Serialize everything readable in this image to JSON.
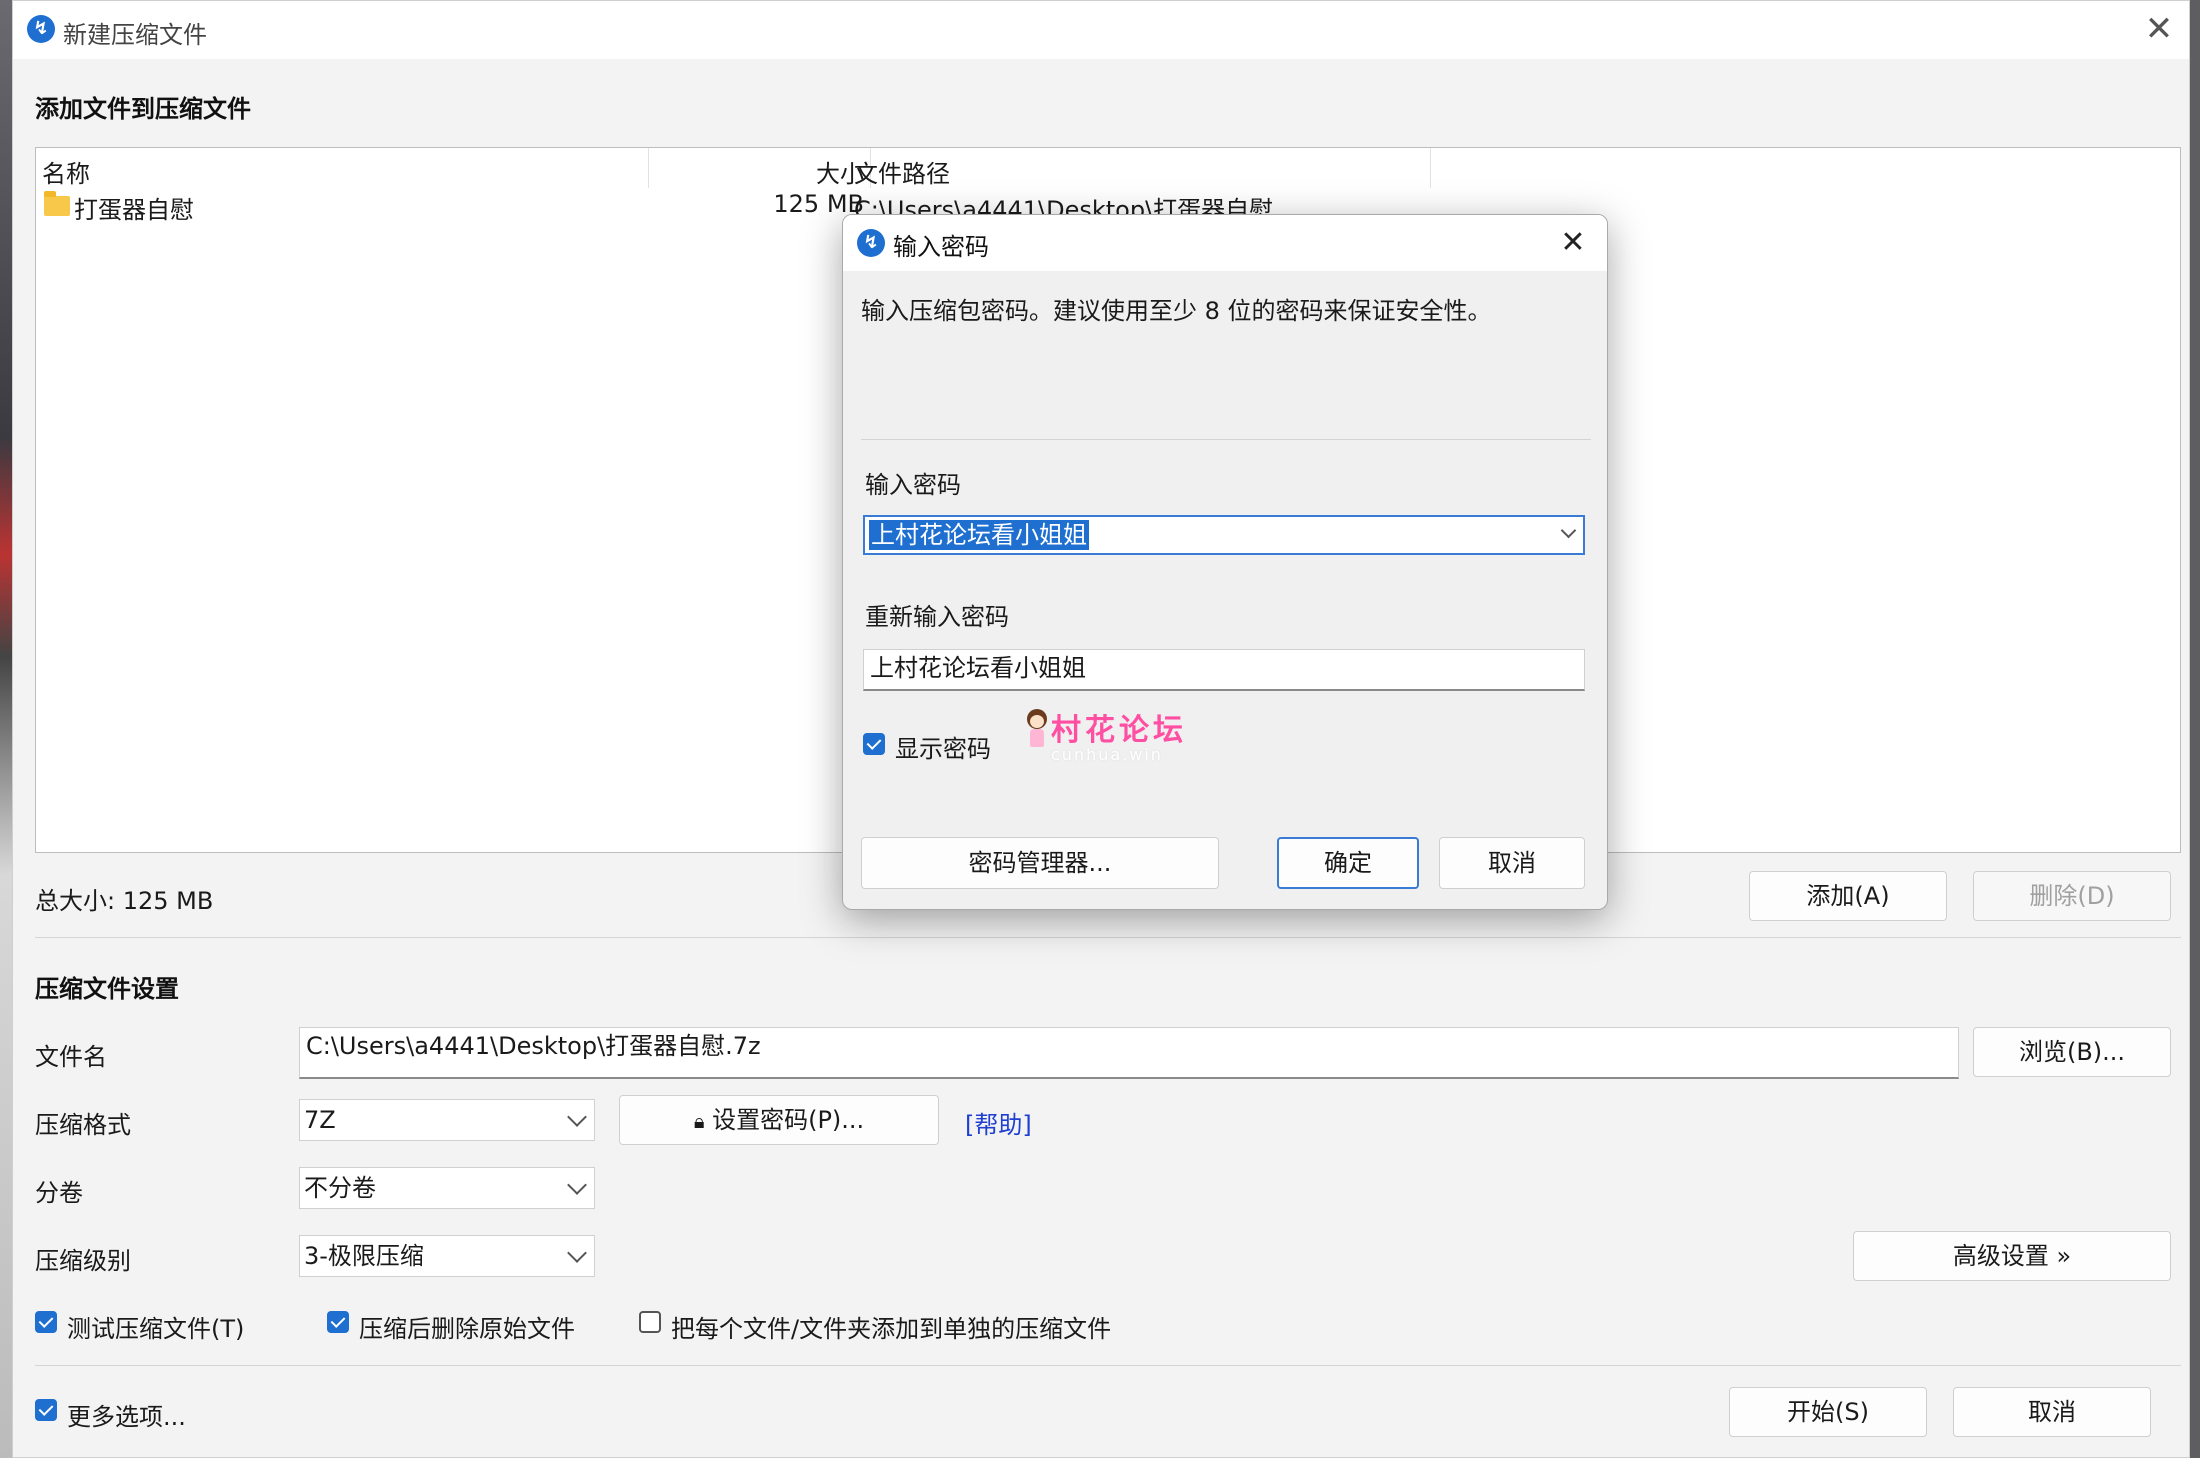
{
  "window": {
    "title": "新建压缩文件",
    "close_glyph": "✕"
  },
  "files_section": {
    "heading": "添加文件到压缩文件",
    "columns": {
      "name": "名称",
      "size": "大小",
      "path": "文件路径"
    },
    "rows": [
      {
        "name": "打蛋器自慰",
        "size": "125 MB",
        "path": "C:\\Users\\a4441\\Desktop\\打蛋器自慰",
        "icon": "folder-icon"
      }
    ],
    "total_size": "总大小: 125 MB",
    "add_button": "添加(A)",
    "delete_button": "删除(D)"
  },
  "settings": {
    "heading": "压缩文件设置",
    "filename_label": "文件名",
    "filename_value": "C:\\Users\\a4441\\Desktop\\打蛋器自慰.7z",
    "browse_button": "浏览(B)...",
    "format_label": "压缩格式",
    "format_value": "7Z",
    "set_password_button": "设置密码(P)...",
    "help_link": "[帮助]",
    "volume_label": "分卷",
    "volume_value": "不分卷",
    "level_label": "压缩级别",
    "level_value": "3-极限压缩",
    "advanced_button": "高级设置 »",
    "checkbox_test": {
      "label": "测试压缩文件(T)",
      "checked": true
    },
    "checkbox_delete_original": {
      "label": "压缩后删除原始文件",
      "checked": true
    },
    "checkbox_separate": {
      "label": "把每个文件/文件夹添加到单独的压缩文件",
      "checked": false
    },
    "checkbox_more": {
      "label": "更多选项...",
      "checked": true
    },
    "start_button": "开始(S)",
    "cancel_button": "取消"
  },
  "password_dialog": {
    "title": "输入密码",
    "description": "输入压缩包密码。建议使用至少 8 位的密码来保证安全性。",
    "password_label": "输入密码",
    "password_value": "上村花论坛看小姐姐",
    "reenter_label": "重新输入密码",
    "reenter_value": "上村花论坛看小姐姐",
    "show_password": {
      "label": "显示密码",
      "checked": true
    },
    "password_manager_button": "密码管理器...",
    "ok_button": "确定",
    "cancel_button": "取消"
  },
  "watermark": {
    "text": "村花论坛",
    "subtext": "cunhua.win"
  },
  "colors": {
    "accent": "#1f6fd1",
    "window_bg": "#f3f3f3",
    "link": "#1f3fd1",
    "watermark": "#ff4fa3"
  }
}
